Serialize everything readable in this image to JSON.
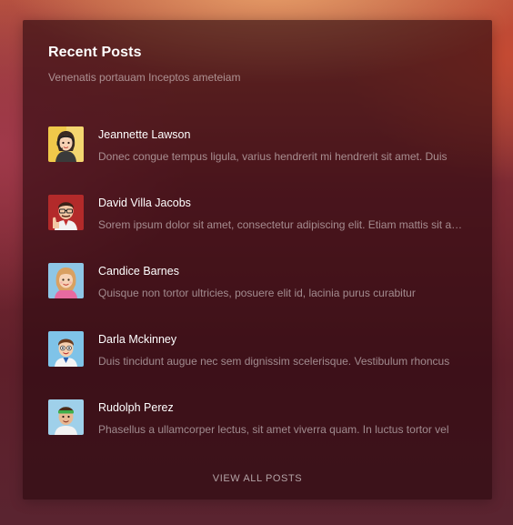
{
  "widget": {
    "title": "Recent Posts",
    "subtitle": "Venenatis portauam Inceptos ameteiam",
    "view_all_label": "VIEW ALL POSTS"
  },
  "posts": [
    {
      "author": "Jeannette Lawson",
      "excerpt": "Donec congue tempus ligula, varius hendrerit mi hendrerit sit amet. Duis",
      "avatar_icon": "woman-headset-avatar-icon",
      "avatar_bg": "#f0c94a"
    },
    {
      "author": "David Villa Jacobs",
      "excerpt": "Sorem ipsum dolor sit amet, consectetur adipiscing elit. Etiam mattis sit amet",
      "avatar_icon": "man-glasses-thumbs-up-avatar-icon",
      "avatar_bg": "#b32a2a"
    },
    {
      "author": "Candice Barnes",
      "excerpt": "Quisque non tortor ultricies, posuere elit id, lacinia purus curabitur",
      "avatar_icon": "woman-blonde-avatar-icon",
      "avatar_bg": "#8ec6e6"
    },
    {
      "author": "Darla Mckinney",
      "excerpt": "Duis tincidunt augue nec sem dignissim scelerisque. Vestibulum rhoncus",
      "avatar_icon": "boy-avatar-icon",
      "avatar_bg": "#7fc3e8"
    },
    {
      "author": "Rudolph Perez",
      "excerpt": "Phasellus a ullamcorper lectus, sit amet viverra quam. In luctus tortor vel",
      "avatar_icon": "man-headband-avatar-icon",
      "avatar_bg": "#9fd0ea"
    }
  ]
}
